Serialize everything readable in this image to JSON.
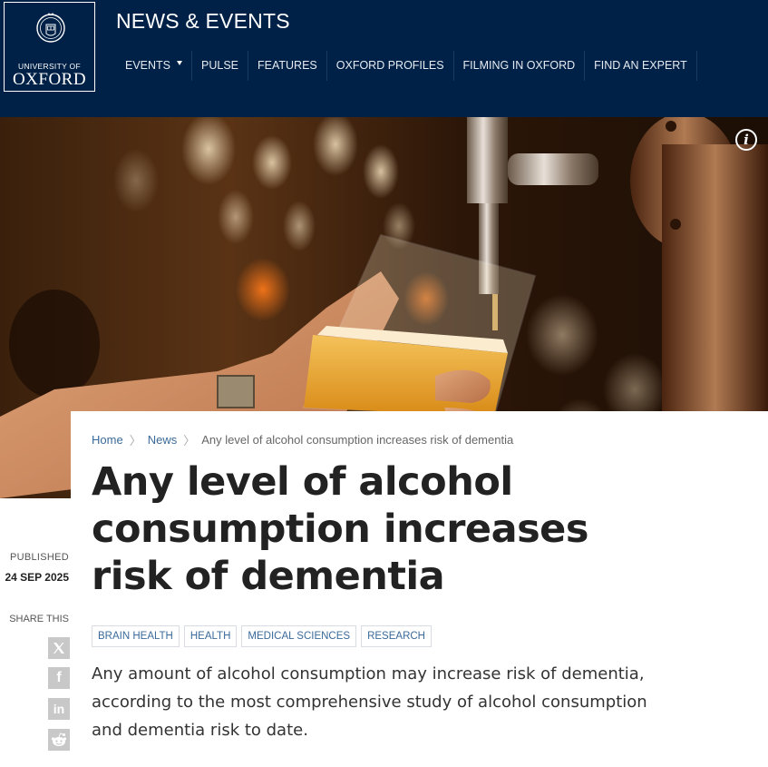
{
  "header": {
    "logo_line1": "UNIVERSITY OF",
    "logo_line2": "OXFORD",
    "site_title": "NEWS & EVENTS",
    "nav": [
      {
        "label": "EVENTS"
      },
      {
        "label": "PULSE"
      },
      {
        "label": "FEATURES"
      },
      {
        "label": "OXFORD PROFILES"
      },
      {
        "label": "FILMING IN OXFORD"
      },
      {
        "label": "FIND AN EXPERT"
      }
    ]
  },
  "hero": {
    "info_icon": "info-icon",
    "info_glyph": "i"
  },
  "breadcrumb": {
    "items": [
      "Home",
      "News",
      "Any level of alcohol consumption increases risk of dementia"
    ],
    "separator": "〉"
  },
  "article": {
    "title": "Any level of alcohol consumption increases risk of dementia",
    "tags": [
      "BRAIN HEALTH",
      "HEALTH",
      "MEDICAL SCIENCES",
      "RESEARCH"
    ],
    "summary": "Any amount of alcohol consumption may increase risk of dementia, according to the most comprehensive study of alcohol consumption and dementia risk to date."
  },
  "meta": {
    "published_label": "PUBLISHED",
    "published_date": "24 SEP 2025",
    "share_label": "SHARE THIS",
    "share_icons": [
      "x-icon",
      "facebook-icon",
      "linkedin-icon",
      "reddit-icon"
    ],
    "share_glyphs": {
      "facebook": "f",
      "linkedin": "in"
    }
  },
  "colors": {
    "header_bg": "#002147",
    "link": "#3a6a9a",
    "text": "#222222"
  }
}
